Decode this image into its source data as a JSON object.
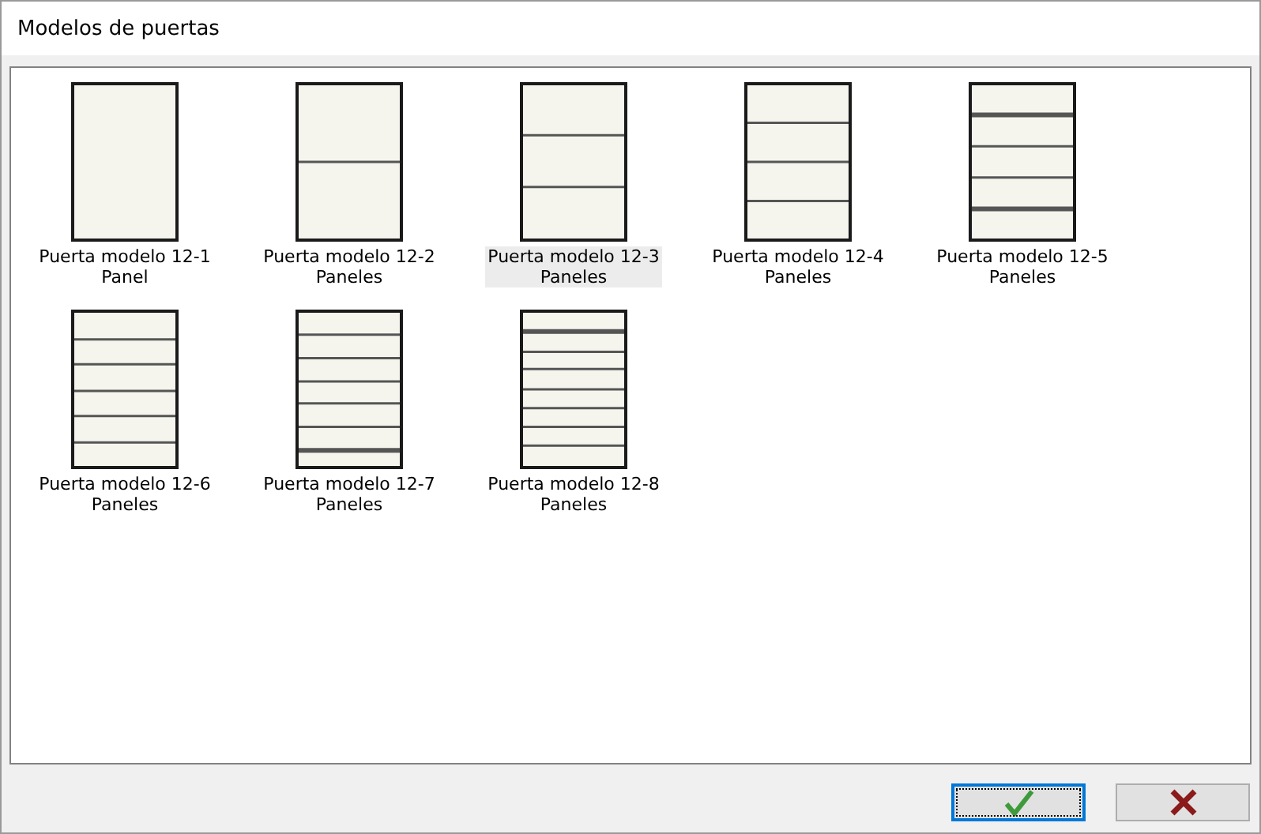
{
  "window": {
    "title": "Modelos de puertas"
  },
  "models": [
    {
      "name": "Puerta modelo 12-1",
      "caption": "Panel",
      "selected": false
    },
    {
      "name": "Puerta modelo 12-2",
      "caption": "Paneles",
      "selected": false
    },
    {
      "name": "Puerta modelo 12-3",
      "caption": "Paneles",
      "selected": true
    },
    {
      "name": "Puerta modelo 12-4",
      "caption": "Paneles",
      "selected": false
    },
    {
      "name": "Puerta modelo 12-5",
      "caption": "Paneles",
      "selected": false
    },
    {
      "name": "Puerta modelo 12-6",
      "caption": "Paneles",
      "selected": false
    },
    {
      "name": "Puerta modelo 12-7",
      "caption": "Paneles",
      "selected": false
    },
    {
      "name": "Puerta modelo 12-8",
      "caption": "Paneles",
      "selected": false
    }
  ],
  "buttons": [
    {
      "kind": "ok"
    },
    {
      "kind": "cancel"
    }
  ]
}
